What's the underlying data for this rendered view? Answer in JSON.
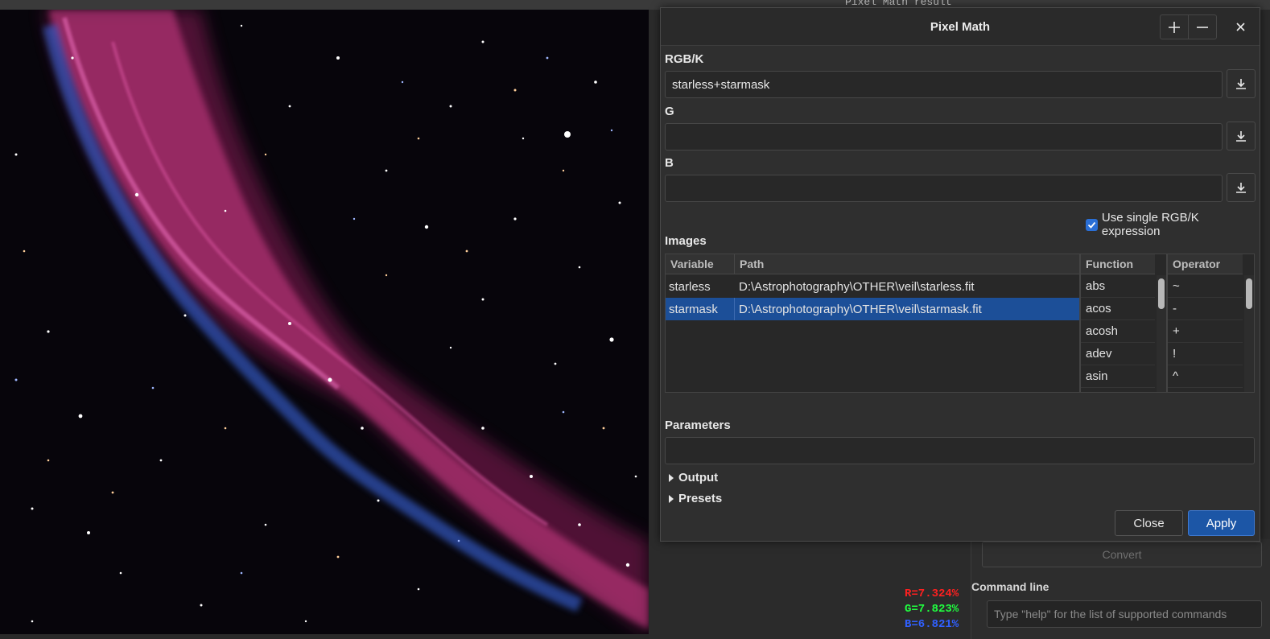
{
  "window": {
    "title_strip": "Pixel Math result"
  },
  "readout": {
    "r": "R=7.324%",
    "g": "G=7.823%",
    "b": "B=6.821%"
  },
  "dialog": {
    "title": "Pixel Math",
    "rgbk_label": "RGB/K",
    "rgbk_value": "starless+starmask",
    "g_label": "G",
    "g_value": "",
    "b_label": "B",
    "b_value": "",
    "use_single_label": "Use single RGB/K expression",
    "use_single_checked": true,
    "images_label": "Images",
    "images_columns": [
      "Variable",
      "Path"
    ],
    "images_rows": [
      {
        "variable": "starless",
        "path": "D:\\Astrophotography\\OTHER\\veil\\starless.fit"
      },
      {
        "variable": "starmask",
        "path": "D:\\Astrophotography\\OTHER\\veil\\starmask.fit"
      }
    ],
    "function_header": "Function",
    "functions": [
      "abs",
      "acos",
      "acosh",
      "adev",
      "asin"
    ],
    "operator_header": "Operator",
    "operators": [
      "~",
      "-",
      "+",
      "!",
      "^"
    ],
    "parameters_label": "Parameters",
    "parameters_value": "",
    "output_label": "Output",
    "presets_label": "Presets",
    "close_label": "Close",
    "apply_label": "Apply"
  },
  "side": {
    "convert_label": "Convert",
    "command_line_label": "Command line",
    "command_placeholder": "Type \"help\" for the list of supported commands"
  },
  "colors": {
    "accent": "#1c56a6",
    "selection": "#1c4f98",
    "readout_r": "#ff2020",
    "readout_g": "#20ff40",
    "readout_b": "#3060ff"
  }
}
